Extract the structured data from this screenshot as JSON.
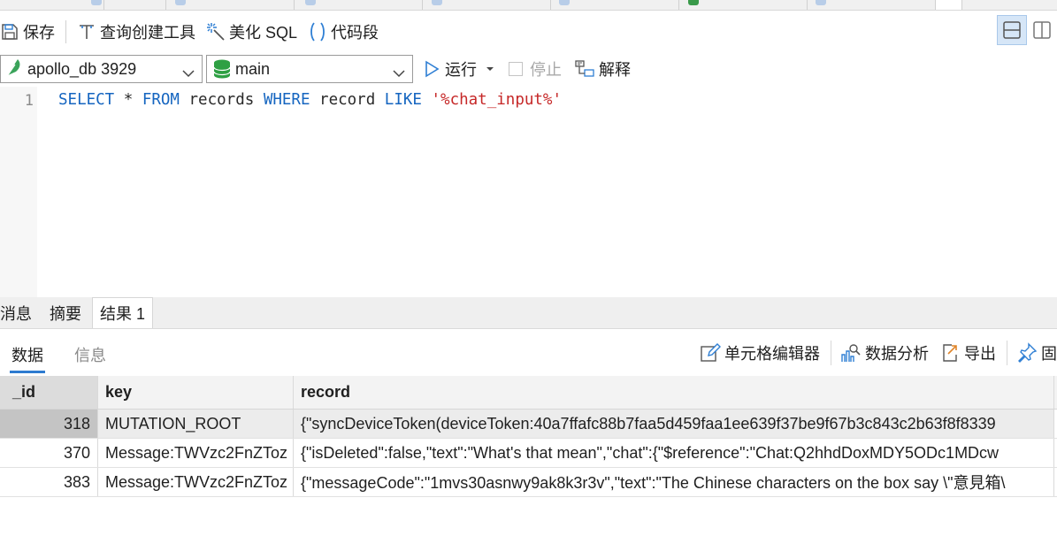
{
  "toolbar": {
    "save": "保存",
    "query_builder": "查询创建工具",
    "beautify_sql": "美化 SQL",
    "code_snippet": "代码段"
  },
  "connection": {
    "database": "apollo_db 3929",
    "schema": "main"
  },
  "run_bar": {
    "run": "运行",
    "stop": "停止",
    "explain": "解释"
  },
  "editor": {
    "line_number": "1",
    "tokens": [
      {
        "t": "SELECT",
        "c": "kw"
      },
      {
        "t": " * ",
        "c": "id"
      },
      {
        "t": "FROM",
        "c": "kw"
      },
      {
        "t": " records ",
        "c": "id"
      },
      {
        "t": "WHERE",
        "c": "kw"
      },
      {
        "t": " record ",
        "c": "id"
      },
      {
        "t": "LIKE",
        "c": "kw"
      },
      {
        "t": " ",
        "c": "id"
      },
      {
        "t": "'%chat_input%'",
        "c": "str"
      }
    ]
  },
  "result_tabs": [
    {
      "label": "消息",
      "active": false
    },
    {
      "label": "摘要",
      "active": false
    },
    {
      "label": "结果 1",
      "active": true
    }
  ],
  "subtabs": {
    "data": "数据",
    "info": "信息"
  },
  "result_tools": {
    "cell_editor": "单元格编辑器",
    "data_analysis": "数据分析",
    "export": "导出",
    "pin": "固"
  },
  "grid": {
    "columns": [
      "_id",
      "key",
      "record"
    ],
    "rows": [
      {
        "id": "318",
        "key": "MUTATION_ROOT",
        "record": "{\"syncDeviceToken(deviceToken:40a7ffafc88b7faa5d459faa1ee639f37be9f67b3c843c2b63f8f8339",
        "selected": true
      },
      {
        "id": "370",
        "key": "Message:TWVzc2FnZToz",
        "record": "{\"isDeleted\":false,\"text\":\"What's that mean\",\"chat\":{\"$reference\":\"Chat:Q2hhdDoxMDY5ODc1MDcw",
        "selected": false
      },
      {
        "id": "383",
        "key": "Message:TWVzc2FnZToz",
        "record": "{\"messageCode\":\"1mvs30asnwy9ak8k3r3v\",\"text\":\"The Chinese characters on the box say \\\"意見箱\\",
        "selected": false
      }
    ]
  },
  "colors": {
    "keyword": "#1565c0",
    "string": "#c62828",
    "accent": "#2e7bd0",
    "icon_blue": "#2f7fd4",
    "db_green": "#2ea043"
  }
}
